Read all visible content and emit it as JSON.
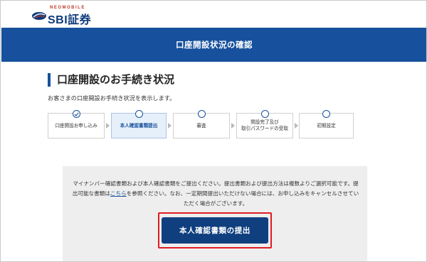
{
  "logo": {
    "neo_text": "NEOMOBILE",
    "brand": "SBI証券",
    "colors": {
      "navy": "#0c3a7a",
      "red": "#c0392b"
    }
  },
  "header": {
    "title": "口座開設状況の確認",
    "bg_color": "#17519d"
  },
  "main": {
    "page_title": "口座開設のお手続き状況",
    "description": "お客さまの口座開設お手続き状況を表示します。",
    "steps": [
      {
        "label_line1": "口座開設お申し込み",
        "label_line2": "",
        "state": "completed"
      },
      {
        "label_line1": "本人確認書類提出",
        "label_line2": "",
        "state": "current"
      },
      {
        "label_line1": "審査",
        "label_line2": "",
        "state": "pending"
      },
      {
        "label_line1": "開設完了及び",
        "label_line2": "取引パスワードの受取",
        "state": "pending"
      },
      {
        "label_line1": "初期設定",
        "label_line2": "",
        "state": "pending"
      }
    ],
    "notice": {
      "part1": "マイナンバー確認書類および本人確認書類をご提出ください。提出書類および提出方法は複数よりご選択可能です。提出可能な書類は",
      "link": "こちら",
      "part2": "を参照ください。なお、一定期間提出いただけない場合には、お申し込みをキャンセルさせていただく場合がございます。"
    },
    "submit_button": "本人確認書類の提出",
    "highlight_color": "#e01b24"
  }
}
